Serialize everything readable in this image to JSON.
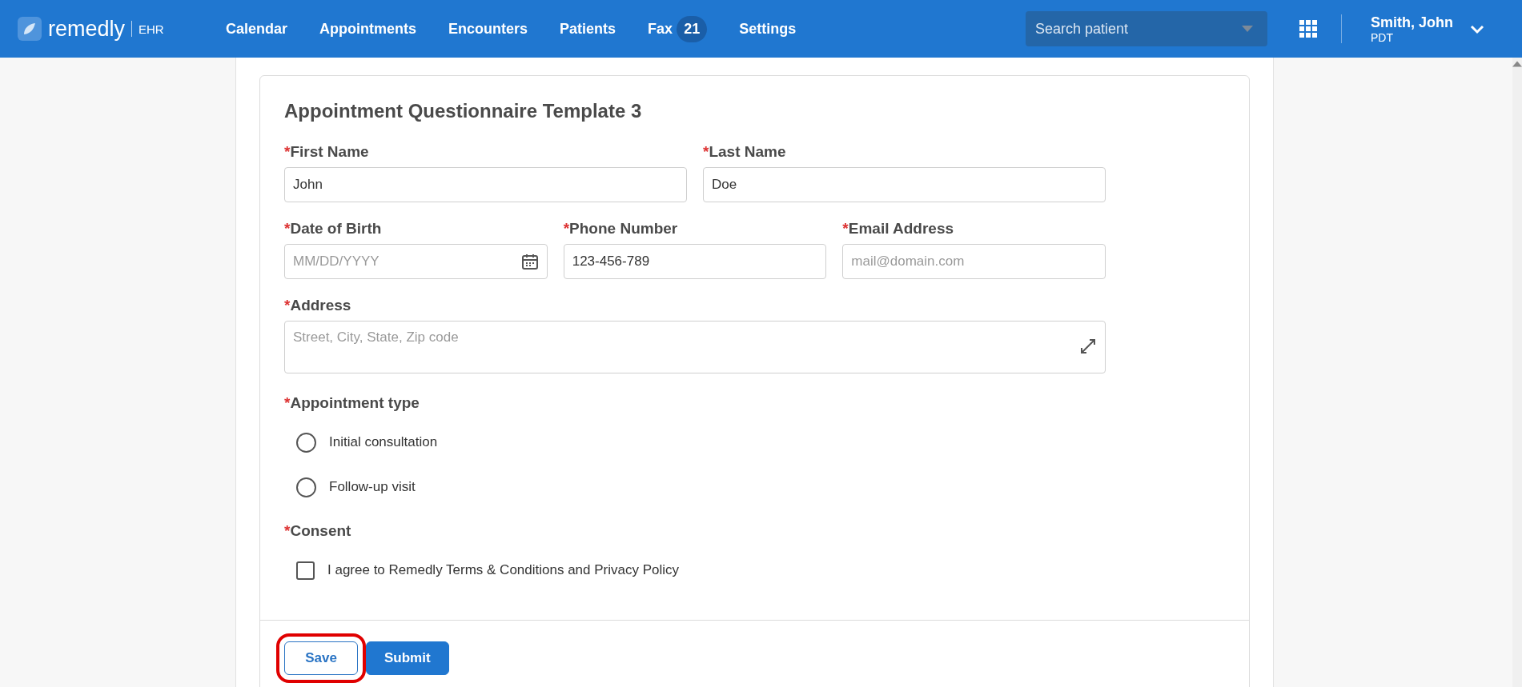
{
  "header": {
    "logo_text": "remedly",
    "logo_suffix": "EHR",
    "nav": [
      {
        "label": "Calendar"
      },
      {
        "label": "Appointments"
      },
      {
        "label": "Encounters"
      },
      {
        "label": "Patients"
      },
      {
        "label": "Fax",
        "badge": "21"
      },
      {
        "label": "Settings"
      }
    ],
    "search": {
      "placeholder": "Search patient"
    },
    "user": {
      "name": "Smith, John",
      "timezone": "PDT"
    }
  },
  "form": {
    "title": "Appointment Questionnaire Template 3",
    "required_mark": "*",
    "rows": [
      [
        {
          "kind": "text",
          "label": "First Name",
          "value": "John"
        },
        {
          "kind": "text",
          "label": "Last Name",
          "value": "Doe"
        }
      ],
      [
        {
          "kind": "date",
          "label": "Date of Birth",
          "placeholder": "MM/DD/YYYY"
        },
        {
          "kind": "text",
          "label": "Phone Number",
          "value": "123-456-789"
        },
        {
          "kind": "text",
          "label": "Email Address",
          "placeholder": "mail@domain.com"
        }
      ],
      [
        {
          "kind": "textarea",
          "label": "Address",
          "placeholder": "Street, City, State, Zip code"
        }
      ]
    ],
    "appointment_type": {
      "label": "Appointment type",
      "options": [
        {
          "label": "Initial consultation",
          "selected": false
        },
        {
          "label": "Follow-up visit",
          "selected": false
        }
      ]
    },
    "consent": {
      "label": "Consent",
      "checkbox": {
        "label": "I agree to Remedly Terms & Conditions and Privacy Policy",
        "checked": false
      }
    },
    "buttons": [
      {
        "kind": "outline",
        "label": "Save",
        "highlighted": true
      },
      {
        "kind": "primary",
        "label": "Submit",
        "highlighted": false
      }
    ]
  }
}
